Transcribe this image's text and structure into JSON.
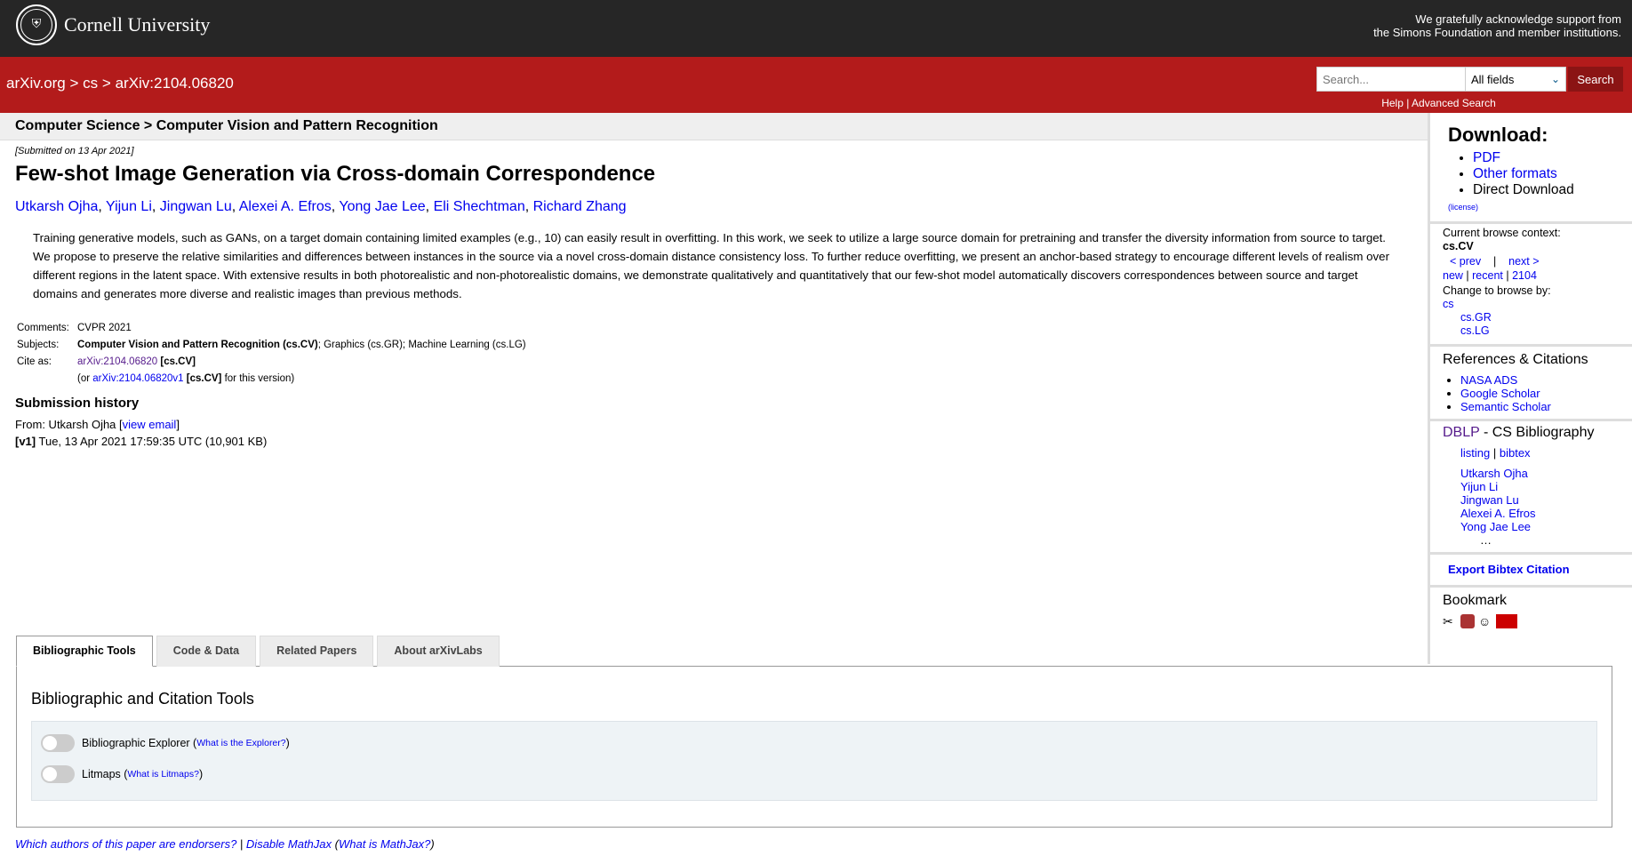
{
  "header": {
    "logo_text": "Cornell University",
    "support_line1": "We gratefully acknowledge support from",
    "support_line2": "the Simons Foundation and member institutions."
  },
  "nav": {
    "breadcrumb_home": "arXiv.org",
    "sep1": ">",
    "breadcrumb_cat": "cs",
    "sep2": ">",
    "breadcrumb_id": "arXiv:2104.06820",
    "search_placeholder": "Search...",
    "search_field": "All fields",
    "search_button": "Search",
    "help": "Help",
    "help_sep": "|",
    "advanced": "Advanced Search"
  },
  "subheader": "Computer Science > Computer Vision and Pattern Recognition",
  "paper": {
    "submitted": "[Submitted on 13 Apr 2021]",
    "title": "Few-shot Image Generation via Cross-domain Correspondence",
    "authors": [
      "Utkarsh Ojha",
      "Yijun Li",
      "Jingwan Lu",
      "Alexei A. Efros",
      "Yong Jae Lee",
      "Eli Shechtman",
      "Richard Zhang"
    ],
    "abstract": "Training generative models, such as GANs, on a target domain containing limited examples (e.g., 10) can easily result in overfitting. In this work, we seek to utilize a large source domain for pretraining and transfer the diversity information from source to target. We propose to preserve the relative similarities and differences between instances in the source via a novel cross-domain distance consistency loss. To further reduce overfitting, we present an anchor-based strategy to encourage different levels of realism over different regions in the latent space. With extensive results in both photorealistic and non-photorealistic domains, we demonstrate qualitatively and quantitatively that our few-shot model automatically discovers correspondences between source and target domains and generates more diverse and realistic images than previous methods."
  },
  "meta": {
    "comments_label": "Comments:",
    "comments": "CVPR 2021",
    "subjects_label": "Subjects:",
    "subject_primary": "Computer Vision and Pattern Recognition (cs.CV)",
    "subject_rest": "; Graphics (cs.GR); Machine Learning (cs.LG)",
    "cite_label": "Cite as:",
    "cite_id": "arXiv:2104.06820",
    "cite_cat": "[cs.CV]",
    "cite_v_pre": "(or ",
    "cite_v_id": "arXiv:2104.06820v1",
    "cite_v_cat": "[cs.CV]",
    "cite_v_post": " for this version)"
  },
  "history": {
    "heading": "Submission history",
    "from": "From: Utkarsh Ojha [",
    "view_email": "view email",
    "from_close": "]",
    "v1_label": "[v1]",
    "v1_text": " Tue, 13 Apr 2021 17:59:35 UTC (10,901 KB)"
  },
  "sidebar": {
    "download_heading": "Download:",
    "pdf": "PDF",
    "other_formats": "Other formats",
    "direct_download": "Direct Download",
    "license": "(license)",
    "browse_context_label": "Current browse context:",
    "browse_context": "cs.CV",
    "prev": "< prev",
    "browse_sep": "|",
    "next": "next >",
    "new": "new",
    "recent": "recent",
    "month": "2104",
    "change_browse": "Change to browse by:",
    "browse_cs": "cs",
    "browse_gr": "cs.GR",
    "browse_lg": "cs.LG",
    "refs_heading": "References & Citations",
    "nasa": "NASA ADS",
    "google": "Google Scholar",
    "semantic": "Semantic Scholar",
    "dblp": "DBLP",
    "dblp_rest": " - CS Bibliography",
    "listing": "listing",
    "bibtex": "bibtex",
    "dblp_authors": [
      "Utkarsh Ojha",
      "Yijun Li",
      "Jingwan Lu",
      "Alexei A. Efros",
      "Yong Jae Lee"
    ],
    "ellipsis": "…",
    "export_bibtex": "Export Bibtex Citation",
    "bookmark": "Bookmark"
  },
  "labs": {
    "tabs": [
      "Bibliographic Tools",
      "Code & Data",
      "Related Papers",
      "About arXivLabs"
    ],
    "panel_heading": "Bibliographic and Citation Tools",
    "explorer_label": "Bibliographic Explorer (",
    "explorer_link": "What is the Explorer?",
    "explorer_close": ")",
    "litmaps_label": "Litmaps (",
    "litmaps_link": "What is Litmaps?",
    "litmaps_close": ")"
  },
  "footer": {
    "endorsers": "Which authors of this paper are endorsers?",
    "sep": " | ",
    "disable_mathjax": "Disable MathJax",
    "open": " (",
    "what_mathjax": "What is MathJax?",
    "close": ")"
  },
  "colors": {
    "topbar": "#262626",
    "arxiv_red": "#b31b1b",
    "link": "#0000ee"
  }
}
